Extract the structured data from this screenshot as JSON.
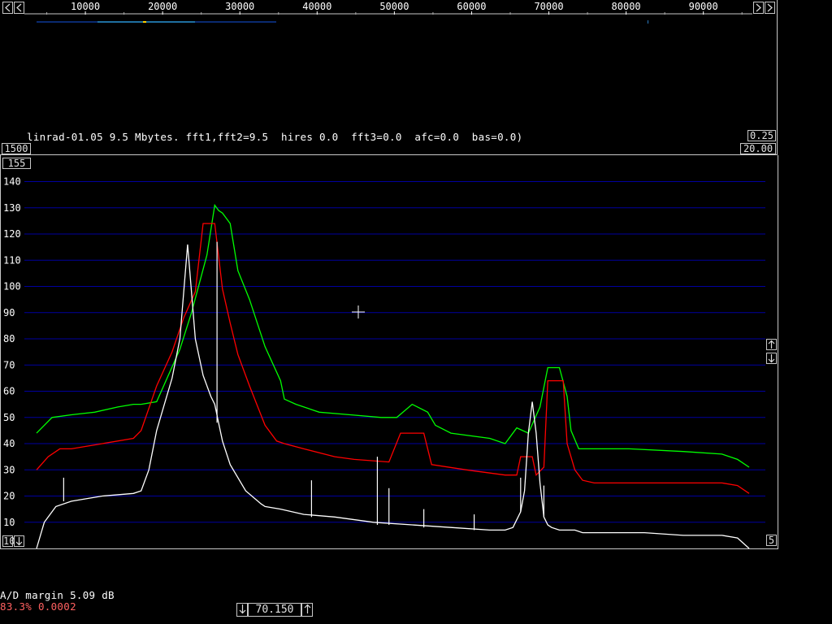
{
  "wide_spectrum": {
    "freq_labels": [
      "10000",
      "20000",
      "30000",
      "40000",
      "50000",
      "60000",
      "70000",
      "80000",
      "90000"
    ],
    "scroll_left_icon": "arrow-left-icon",
    "scroll_right_icon": "arrow-right-icon",
    "zoom_left_icon": "arrow-left-icon",
    "zoom_right_icon": "arrow-right-icon",
    "fft_avg_box": "1500",
    "gain_box": "0.25",
    "db_range_box": "20.00"
  },
  "status_line": "linrad-01.05 9.5 Mbytes. fft1,fft2=9.5  hires 0.0  fft3=0.0  afc=0.0  bas=0.0)",
  "spectrum_graph": {
    "top_box": "155",
    "y_labels": [
      "140",
      "130",
      "120",
      "110",
      "100",
      "90",
      "80",
      "70",
      "60",
      "50",
      "40",
      "30",
      "20",
      "10"
    ],
    "bottom_left_box": "10",
    "bottom_right_box": "5",
    "colors": {
      "grid": "#0000a0",
      "green": "#00ff00",
      "red": "#ff0000",
      "white": "#ffffff",
      "frame": "#c8c8c8"
    }
  },
  "chart_data": {
    "type": "line",
    "xlabel": "",
    "ylabel": "",
    "xlim": [
      0,
      96000
    ],
    "ylim": [
      0,
      155
    ],
    "x_ticks": [
      10000,
      20000,
      30000,
      40000,
      50000,
      60000,
      70000,
      80000,
      90000
    ],
    "y_ticks": [
      10,
      20,
      30,
      40,
      50,
      60,
      70,
      80,
      90,
      100,
      110,
      120,
      130,
      140
    ],
    "grid": true,
    "series": [
      {
        "color": "#00ff00",
        "x": [
          1500,
          3500,
          6000,
          9000,
          12000,
          14000,
          15000,
          17000,
          20000,
          21500,
          22500,
          23500,
          24500,
          25000,
          25500,
          26500,
          27500,
          29000,
          31000,
          33000,
          33500,
          35000,
          38000,
          42000,
          46000,
          48000,
          50000,
          52000,
          53000,
          55000,
          60000,
          62000,
          63500,
          65000,
          66500,
          67500,
          68000,
          69000,
          70000,
          70500,
          71500,
          72500,
          74000,
          76000,
          78000,
          85000,
          90000,
          92000,
          93500
        ],
        "y": [
          44,
          50,
          51,
          52,
          54,
          55,
          55,
          56,
          76,
          90,
          101,
          112,
          131,
          129,
          128,
          124,
          106,
          95,
          77,
          64,
          57,
          55,
          52,
          51,
          50,
          50,
          55,
          52,
          47,
          44,
          42,
          40,
          46,
          44,
          54,
          69,
          69,
          69,
          58,
          45,
          38,
          38,
          38,
          38,
          38,
          37,
          36,
          34,
          31
        ]
      },
      {
        "color": "#ff0000",
        "x": [
          1500,
          3000,
          4500,
          6000,
          10000,
          14000,
          15000,
          17000,
          19000,
          20500,
          22000,
          23000,
          24000,
          24500,
          25500,
          26500,
          27500,
          29000,
          31000,
          32500,
          33500,
          36000,
          40000,
          42500,
          47000,
          48500,
          50000,
          51500,
          52500,
          57000,
          62000,
          63500,
          64000,
          65500,
          66000,
          67000,
          67500,
          68500,
          69500,
          70000,
          71000,
          72000,
          73500,
          75000,
          77000,
          80000,
          85000,
          90000,
          92000,
          93500
        ],
        "y": [
          30,
          35,
          38,
          38,
          40,
          42,
          45,
          62,
          75,
          88,
          98,
          124,
          124,
          124,
          99,
          86,
          74,
          62,
          47,
          41,
          40,
          38,
          35,
          34,
          33,
          44,
          44,
          44,
          32,
          30,
          28,
          28,
          35,
          35,
          28,
          31,
          64,
          64,
          64,
          40,
          30,
          26,
          25,
          25,
          25,
          25,
          25,
          25,
          24,
          21
        ],
        "shape": "flat-topped peaks (peak-hold)"
      },
      {
        "color": "#ffffff",
        "x": [
          1500,
          2500,
          4000,
          6000,
          10000,
          14000,
          15000,
          16000,
          17000,
          18000,
          19000,
          20000,
          21000,
          22000,
          23000,
          24000,
          24500,
          25000,
          25500,
          26500,
          28500,
          30500,
          31000,
          33000,
          36000,
          40000,
          45000,
          50000,
          55000,
          60000,
          62000,
          63000,
          64000,
          64500,
          65000,
          65500,
          66000,
          66500,
          67000,
          67500,
          68000,
          69000,
          70000,
          71000,
          72000,
          73000,
          75000,
          80000,
          85000,
          90000,
          92000,
          93500
        ],
        "y": [
          0,
          10,
          16,
          18,
          20,
          21,
          22,
          30,
          45,
          55,
          65,
          80,
          116,
          80,
          66,
          58,
          55,
          48,
          41,
          32,
          22,
          17,
          16,
          15,
          13,
          12,
          10,
          9,
          8,
          7,
          7,
          8,
          14,
          22,
          44,
          56,
          44,
          25,
          12,
          9,
          8,
          7,
          7,
          7,
          6,
          6,
          6,
          6,
          5,
          5,
          4,
          0
        ],
        "spikes": [
          [
            5000,
            27
          ],
          [
            24800,
            117
          ],
          [
            37000,
            26
          ],
          [
            45500,
            35
          ],
          [
            47000,
            23
          ],
          [
            51500,
            15
          ],
          [
            58000,
            13
          ],
          [
            64000,
            27
          ],
          [
            67000,
            24
          ]
        ]
      }
    ]
  },
  "bottom": {
    "ad_margin": "A/D margin 5.09 dB",
    "cpu_load": "83.3% 0.0002",
    "freq_down_icon": "arrow-down-icon",
    "freq_value": "70.150",
    "freq_up_icon": "arrow-up-icon"
  },
  "side_controls": {
    "up_icon": "arrow-up-icon",
    "down_icon": "arrow-down-icon",
    "left_down_icon": "arrow-down-icon",
    "left_up_icon": "arrow-up-icon"
  }
}
